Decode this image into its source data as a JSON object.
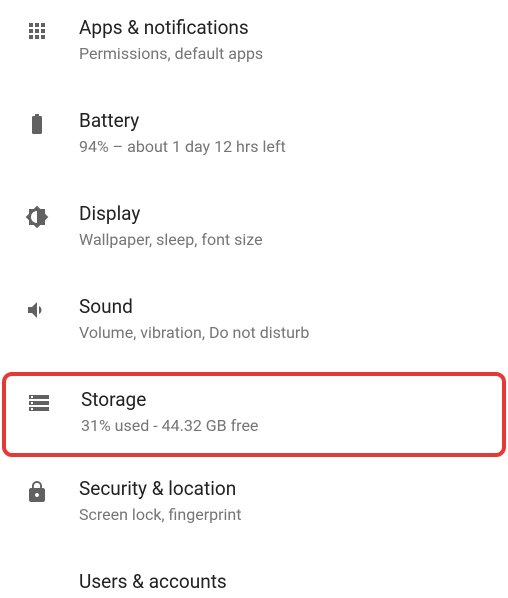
{
  "settings": [
    {
      "icon": "apps-icon",
      "title": "Apps & notifications",
      "subtitle": "Permissions, default apps"
    },
    {
      "icon": "battery-icon",
      "title": "Battery",
      "subtitle": "94% – about 1 day 12 hrs left"
    },
    {
      "icon": "display-icon",
      "title": "Display",
      "subtitle": "Wallpaper, sleep, font size"
    },
    {
      "icon": "sound-icon",
      "title": "Sound",
      "subtitle": "Volume, vibration, Do not disturb"
    },
    {
      "icon": "storage-icon",
      "title": "Storage",
      "subtitle": "31% used - 44.32 GB free",
      "highlighted": true
    },
    {
      "icon": "lock-icon",
      "title": "Security & location",
      "subtitle": "Screen lock, fingerprint"
    },
    {
      "icon": "users-icon",
      "title": "Users & accounts",
      "subtitle": ""
    }
  ],
  "highlight_color": "#e53935"
}
